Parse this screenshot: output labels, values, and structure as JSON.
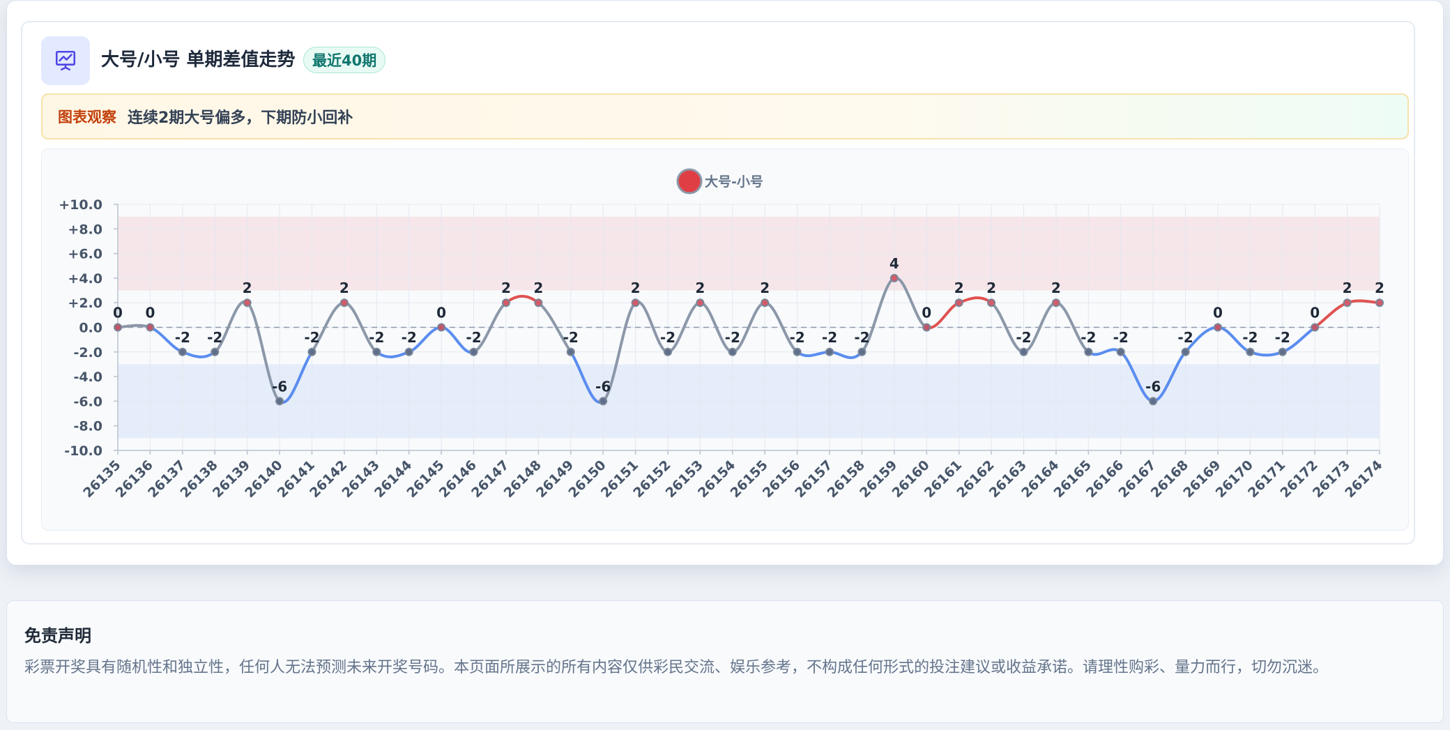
{
  "header": {
    "title": "大号/小号 单期差值走势",
    "badge": "最近40期",
    "icon": "presentation-chart-icon"
  },
  "observation": {
    "label": "图表观察",
    "text": "连续2期大号偏多，下期防小回补"
  },
  "colors": {
    "positive": "#e05252",
    "negative": "#5b8def",
    "neutral": "#8c98a9",
    "band_high": "#f6e6ea",
    "band_low": "#e6edfa"
  },
  "chart_data": {
    "type": "line",
    "categories": [
      "26135",
      "26136",
      "26137",
      "26138",
      "26139",
      "26140",
      "26141",
      "26142",
      "26143",
      "26144",
      "26145",
      "26146",
      "26147",
      "26148",
      "26149",
      "26150",
      "26151",
      "26152",
      "26153",
      "26154",
      "26155",
      "26156",
      "26157",
      "26158",
      "26159",
      "26160",
      "26161",
      "26162",
      "26163",
      "26164",
      "26165",
      "26166",
      "26167",
      "26168",
      "26169",
      "26170",
      "26171",
      "26172",
      "26173",
      "26174"
    ],
    "series": [
      {
        "name": "大号-小号",
        "values": [
          0,
          0,
          -2,
          -2,
          2,
          -6,
          -2,
          2,
          -2,
          -2,
          0,
          -2,
          2,
          2,
          -2,
          -6,
          2,
          -2,
          2,
          -2,
          2,
          -2,
          -2,
          -2,
          4,
          0,
          2,
          2,
          -2,
          2,
          -2,
          -2,
          -6,
          -2,
          0,
          -2,
          -2,
          0,
          2,
          2
        ]
      }
    ],
    "ylim": [
      -10,
      10
    ],
    "yticks": [
      "+10.0",
      "+8.0",
      "+6.0",
      "+4.0",
      "+2.0",
      "0.0",
      "-2.0",
      "-4.0",
      "-6.0",
      "-8.0",
      "-10.0"
    ],
    "bands": [
      {
        "from": 3,
        "to": 9,
        "tone": "high"
      },
      {
        "from": -9,
        "to": -3,
        "tone": "low"
      }
    ],
    "zero_line": "dashed",
    "grid": true,
    "legend": "top-center"
  },
  "disclaimer": {
    "title": "免责声明",
    "text": "彩票开奖具有随机性和独立性，任何人无法预测未来开奖号码。本页面所展示的所有内容仅供彩民交流、娱乐参考，不构成任何形式的投注建议或收益承诺。请理性购彩、量力而行，切勿沉迷。"
  }
}
